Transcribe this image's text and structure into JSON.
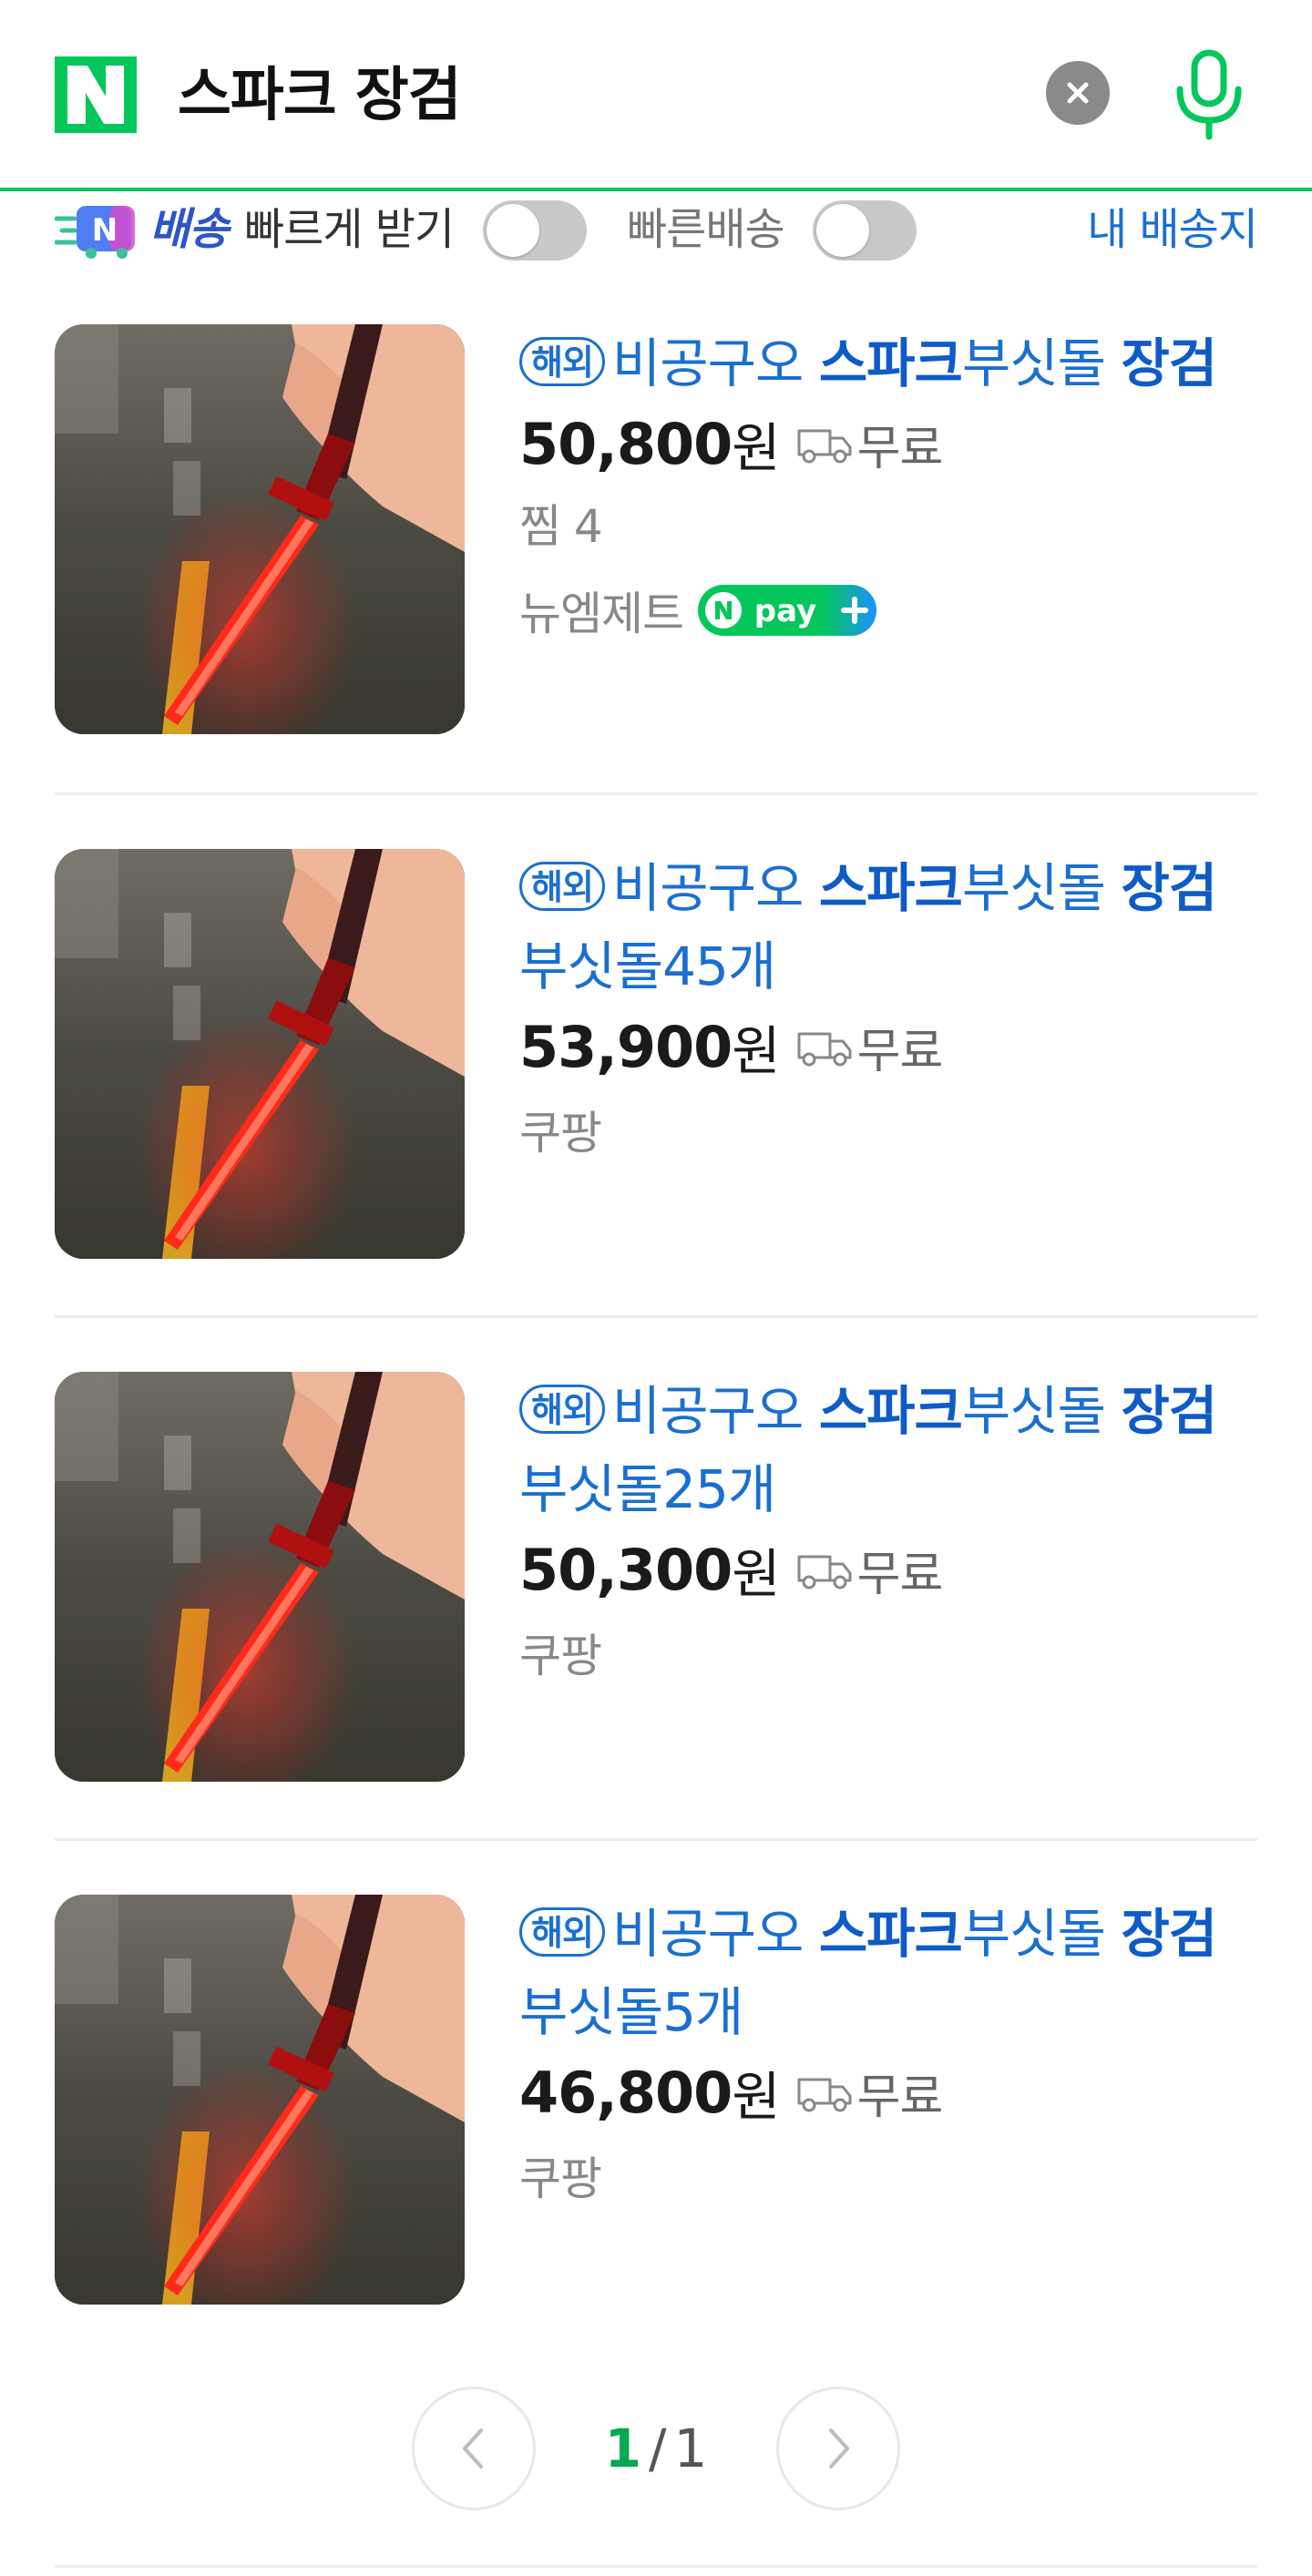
{
  "search": {
    "query": "스파크 장검"
  },
  "filters": {
    "fast_delivery_badge": "N",
    "fast_delivery_label_highlight": "배송",
    "fast_delivery_label": "빠르게 받기",
    "fast_delivery_on": false,
    "quick_delivery_label": "빠른배송",
    "quick_delivery_on": false,
    "my_address_label": "내 배송지"
  },
  "colors": {
    "brand_green": "#03c75a",
    "link_blue": "#1a6fd1",
    "npay_green": "#03c75a"
  },
  "products": [
    {
      "tag": "해외",
      "title_parts": [
        "비공구오 ",
        "스파크",
        "부싯돌 ",
        "장검",
        ""
      ],
      "price": "50,800",
      "currency": "원",
      "shipping": "무료",
      "likes": "찜 4",
      "seller": "뉴엠제트",
      "npay": true,
      "image": "red-glowing-sword-photo"
    },
    {
      "tag": "해외",
      "title_parts": [
        "비공구오 ",
        "스파크",
        "부싯돌 ",
        "장검",
        " 부싯돌45개"
      ],
      "price": "53,900",
      "currency": "원",
      "shipping": "무료",
      "seller": "쿠팡",
      "npay": false,
      "image": "red-glowing-sword-photo"
    },
    {
      "tag": "해외",
      "title_parts": [
        "비공구오 ",
        "스파크",
        "부싯돌 ",
        "장검",
        " 부싯돌25개"
      ],
      "price": "50,300",
      "currency": "원",
      "shipping": "무료",
      "seller": "쿠팡",
      "npay": false,
      "image": "red-glowing-sword-photo"
    },
    {
      "tag": "해외",
      "title_parts": [
        "비공구오 ",
        "스파크",
        "부싯돌 ",
        "장검",
        " 부싯돌5개"
      ],
      "price": "46,800",
      "currency": "원",
      "shipping": "무료",
      "seller": "쿠팡",
      "npay": false,
      "image": "red-glowing-sword-photo"
    }
  ],
  "pagination": {
    "current": "1",
    "separator": "/",
    "total": "1"
  },
  "npay_label": "pay"
}
